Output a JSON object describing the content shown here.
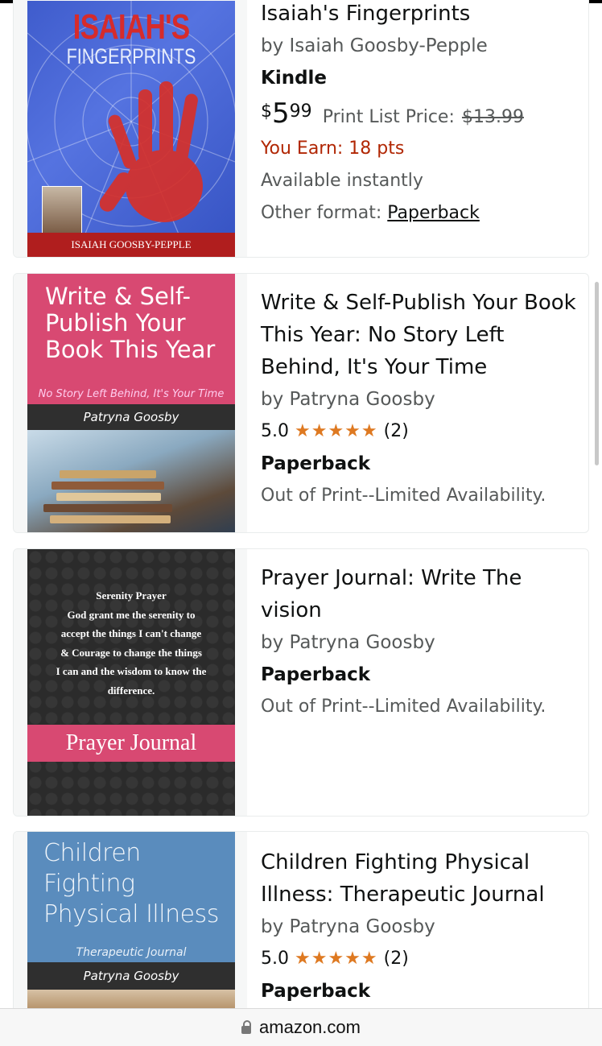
{
  "colors": {
    "accent_price": "#b12704",
    "star": "#de7921",
    "muted": "#565959"
  },
  "items": [
    {
      "cover": {
        "title_line1": "ISAIAH'S",
        "title_line2": "FINGERPRINTS",
        "author_band": "ISAIAH GOOSBY-PEPPLE"
      },
      "title": "Isaiah's Fingerprints",
      "author": "by Isaiah Goosby-Pepple",
      "format": "Kindle",
      "price": {
        "symbol": "$",
        "whole": "5",
        "fraction": "99"
      },
      "list_price_label": "Print List Price:",
      "list_price": "$13.99",
      "earn": "You Earn: 18 pts",
      "availability": "Available instantly",
      "other_format_label": "Other format:",
      "other_format_link": "Paperback"
    },
    {
      "cover": {
        "title": "Write & Self-\nPublish Your\nBook This Year",
        "subtitle": "No Story Left Behind, It's Your Time",
        "author": "Patryna Goosby"
      },
      "title_lines": [
        "Write & Self-Publish Your Book",
        "This Year: No Story Left",
        "Behind, It's Your Time"
      ],
      "author": "by Patryna Goosby",
      "rating": "5.0",
      "stars": "★★★★★",
      "rating_count": "(2)",
      "format": "Paperback",
      "availability": "Out of Print--Limited Availability."
    },
    {
      "cover": {
        "verse": [
          "Serenity Prayer",
          "God grant me the serenity to",
          "accept the things I can't change",
          "& Courage to change the things",
          "I can and the wisdom to know the",
          "difference."
        ],
        "band": "Prayer Journal"
      },
      "title_lines": [
        "Prayer Journal: Write The",
        "vision"
      ],
      "author": "by Patryna Goosby",
      "format": "Paperback",
      "availability": "Out of Print--Limited Availability."
    },
    {
      "cover": {
        "title_lines": [
          "Children",
          "Fighting",
          "Physical Illness"
        ],
        "subtitle": "Therapeutic Journal",
        "author": "Patryna Goosby"
      },
      "title_lines": [
        "Children Fighting Physical",
        "Illness: Therapeutic Journal"
      ],
      "author": "by Patryna Goosby",
      "rating": "5.0",
      "stars": "★★★★★",
      "rating_count": "(2)",
      "format": "Paperback"
    }
  ],
  "browser": {
    "domain": "amazon.com"
  }
}
